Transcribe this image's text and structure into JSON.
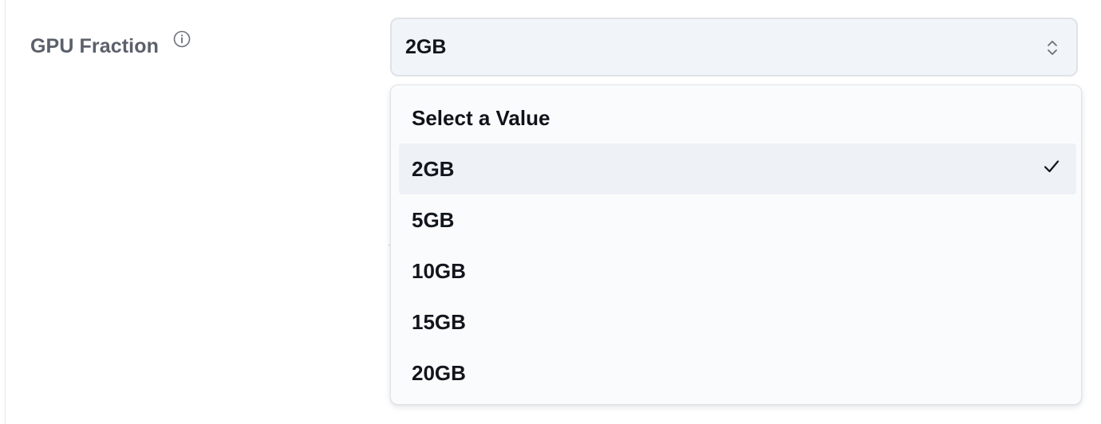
{
  "field": {
    "label": "GPU Fraction",
    "info_icon": "info-circle-icon"
  },
  "select": {
    "value": "2GB",
    "toggle_icon": "chevron-up-down-icon"
  },
  "dropdown": {
    "header": "Select a Value",
    "selected_icon": "checkmark-icon",
    "options": [
      {
        "label": "2GB",
        "selected": true
      },
      {
        "label": "5GB",
        "selected": false
      },
      {
        "label": "10GB",
        "selected": false
      },
      {
        "label": "15GB",
        "selected": false
      },
      {
        "label": "20GB",
        "selected": false
      }
    ]
  },
  "colors": {
    "label_text": "#5b606b",
    "value_text": "#11151c",
    "trigger_bg": "#f1f4f8",
    "menu_bg": "#fafbfc",
    "selected_bg": "#eef1f6",
    "border": "#dfe3e8"
  }
}
